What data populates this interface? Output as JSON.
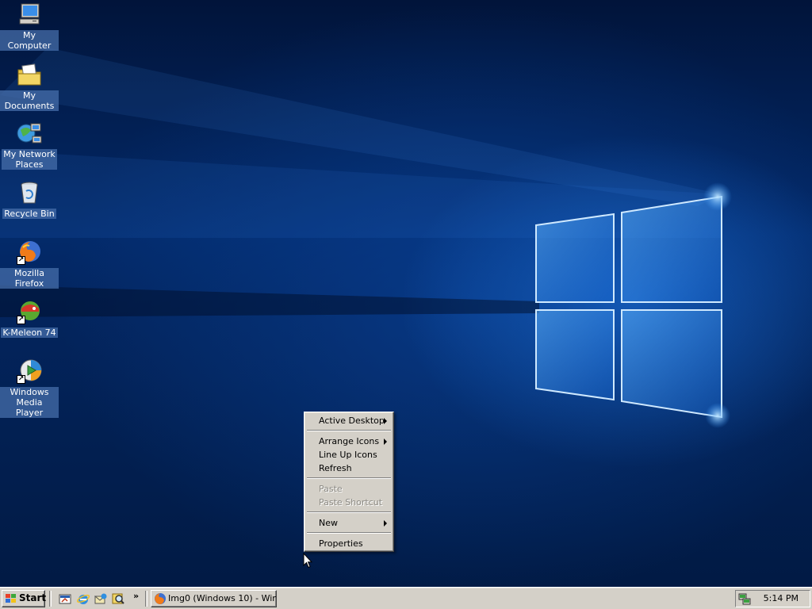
{
  "desktop": {
    "icons": [
      {
        "label": "My Computer",
        "icon": "my-computer-icon"
      },
      {
        "label": "My Documents",
        "icon": "my-documents-icon"
      },
      {
        "label": "My Network\nPlaces",
        "icon": "network-places-icon"
      },
      {
        "label": "Recycle Bin",
        "icon": "recycle-bin-icon"
      },
      {
        "label": "Mozilla Firefox",
        "icon": "firefox-icon"
      },
      {
        "label": "K-Meleon 74",
        "icon": "k-meleon-icon"
      },
      {
        "label": "Windows\nMedia Player",
        "icon": "media-player-icon"
      }
    ]
  },
  "context_menu": {
    "items": [
      {
        "label": "Active Desktop",
        "submenu": true,
        "disabled": false
      },
      {
        "label": "Arrange Icons",
        "submenu": true,
        "disabled": false
      },
      {
        "label": "Line Up Icons",
        "submenu": false,
        "disabled": false
      },
      {
        "label": "Refresh",
        "submenu": false,
        "disabled": false
      },
      {
        "label": "Paste",
        "submenu": false,
        "disabled": true
      },
      {
        "label": "Paste Shortcut",
        "submenu": false,
        "disabled": true
      },
      {
        "label": "New",
        "submenu": true,
        "disabled": false
      },
      {
        "label": "Properties",
        "submenu": false,
        "disabled": false
      }
    ]
  },
  "taskbar": {
    "start_label": "Start",
    "quick_launch_more": "»",
    "task_button_label": "Img0 (Windows 10) - Win...",
    "clock": "5:14 PM"
  },
  "colors": {
    "chrome": "#d4d0c8",
    "desktop_bg": "#032a6a",
    "label_highlight": "#466eaa"
  }
}
